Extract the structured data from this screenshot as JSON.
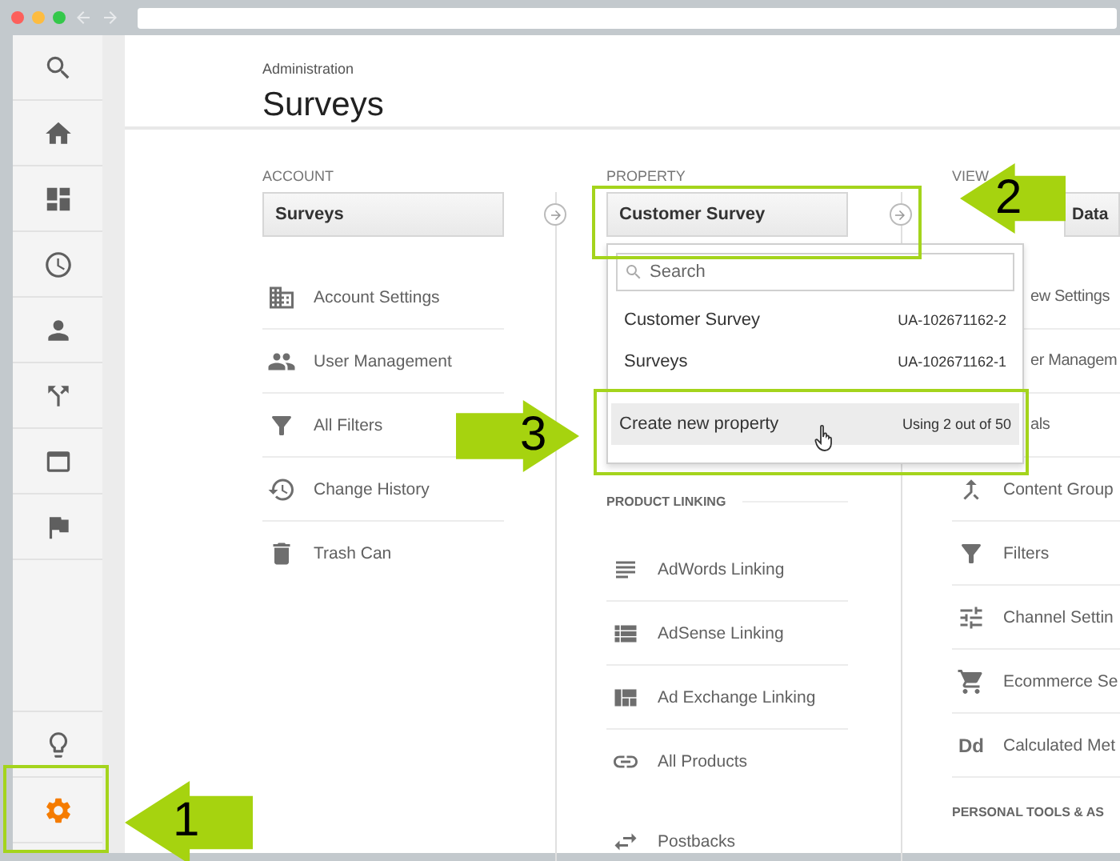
{
  "browser": {
    "traffic_lights": [
      {
        "color": "#fc605c"
      },
      {
        "color": "#fdbc40"
      },
      {
        "color": "#34c84a"
      }
    ]
  },
  "sidebar": {
    "items": [
      {
        "selected": false
      },
      {
        "selected": false
      },
      {
        "selected": false
      },
      {
        "selected": false
      },
      {
        "selected": false
      },
      {
        "selected": false
      },
      {
        "selected": false
      },
      {
        "selected": false
      }
    ],
    "bottom_items": [
      {
        "selected": false
      },
      {
        "selected": true
      }
    ]
  },
  "header": {
    "breadcrumb": "Administration",
    "title": "Surveys"
  },
  "account": {
    "label": "ACCOUNT",
    "selector": "Surveys",
    "items": [
      {
        "label": "Account Settings"
      },
      {
        "label": "User Management"
      },
      {
        "label": "All Filters"
      },
      {
        "label": "Change History"
      },
      {
        "label": "Trash Can"
      }
    ]
  },
  "property": {
    "label": "PROPERTY",
    "selector": "Customer Survey",
    "dropdown": {
      "expanded": true,
      "placeholder": "Search",
      "options": [
        {
          "name": "Customer Survey",
          "id": "UA-102671162-2"
        },
        {
          "name": "Surveys",
          "id": "UA-102671162-1"
        }
      ],
      "create": {
        "label": "Create new property",
        "usage": "Using 2 out of 50",
        "hovered": true
      }
    },
    "section": "PRODUCT LINKING",
    "items": [
      {
        "label": "AdWords Linking"
      },
      {
        "label": "AdSense Linking"
      },
      {
        "label": "Ad Exchange Linking"
      },
      {
        "label": "All Products"
      },
      {
        "label": "Postbacks"
      }
    ]
  },
  "view": {
    "label": "VIEW",
    "selector": "Data",
    "items": [
      {
        "kind": "cut",
        "label": "ew Settings"
      },
      {
        "kind": "cut",
        "label": "er Managem"
      },
      {
        "kind": "cut",
        "label": "als"
      },
      {
        "kind": "item",
        "label": "Content Group"
      },
      {
        "kind": "item",
        "label": "Filters"
      },
      {
        "kind": "item",
        "label": "Channel Settin"
      },
      {
        "kind": "item",
        "label": "Ecommerce Se"
      },
      {
        "kind": "glyph",
        "glyph": "Dd",
        "label": "Calculated Met"
      }
    ],
    "section": "PERSONAL TOOLS & AS"
  },
  "callouts": [
    {
      "number": "1"
    },
    {
      "number": "2"
    },
    {
      "number": "3"
    }
  ]
}
